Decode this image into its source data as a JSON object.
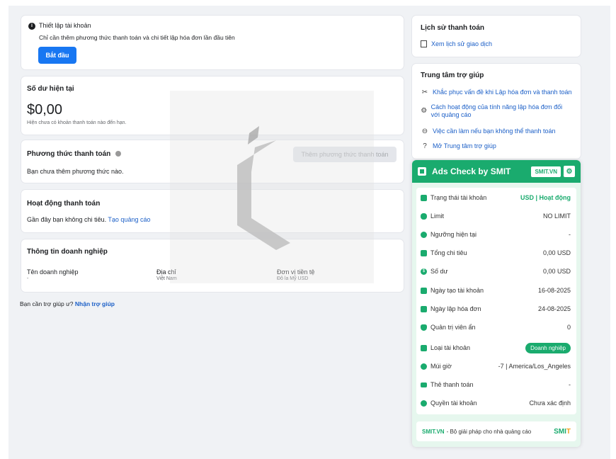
{
  "setup": {
    "title": "Thiết lập tài khoản",
    "desc": "Chỉ cần thêm phương thức thanh toán và chi tiết lập hóa đơn lần đầu tiên",
    "button": "Bắt đầu"
  },
  "balance": {
    "title": "Số dư hiện tại",
    "amount": "$0,00",
    "note": "Hiện chưa có khoản thanh toán nào đến hạn."
  },
  "payment_method": {
    "title": "Phương thức thanh toán",
    "desc": "Bạn chưa thêm phương thức nào.",
    "button": "Thêm phương thức thanh toán"
  },
  "activity": {
    "title": "Hoạt động thanh toán",
    "desc": "Gần đây bạn không chi tiêu.",
    "link": "Tạo quảng cáo"
  },
  "business": {
    "title": "Thông tin doanh nghiệp",
    "col1_label": "Tên doanh nghiệp",
    "col1_value": "-",
    "col2_label": "Địa chỉ",
    "col2_value": "Việt Nam",
    "col3_label": "Đơn vị tiền tệ",
    "col3_value": "Đô la Mỹ USD"
  },
  "help_footer": {
    "text": "Bạn cần trợ giúp ư?",
    "link": "Nhận trợ giúp"
  },
  "history": {
    "title": "Lịch sử thanh toán",
    "link": "Xem lịch sử giao dịch"
  },
  "help_center": {
    "title": "Trung tâm trợ giúp",
    "items": [
      "Khắc phục vấn đề khi Lập hóa đơn và thanh toán",
      "Cách hoạt động của tính năng lập hóa đơn đối với quảng cáo",
      "Việc cần làm nếu bạn không thể thanh toán",
      "Mở Trung tâm trợ giúp"
    ]
  },
  "smit": {
    "title": "Ads Check by SMIT",
    "tag": "SMIT.VN",
    "rows": [
      {
        "label": "Trạng thái tài khoản",
        "value": "USD | Hoạt động"
      },
      {
        "label": "Limit",
        "value": "NO LIMIT"
      },
      {
        "label": "Ngưỡng hiện tại",
        "value": "-"
      },
      {
        "label": "Tổng chi tiêu",
        "value": "0,00 USD"
      },
      {
        "label": "Số dư",
        "value": "0,00 USD"
      },
      {
        "label": "Ngày tạo tài khoản",
        "value": "16-08-2025"
      },
      {
        "label": "Ngày lập hóa đơn",
        "value": "24-08-2025"
      },
      {
        "label": "Quản trị viên ẩn",
        "value": "0"
      },
      {
        "label": "Loại tài khoản",
        "value": "Doanh nghiệp"
      },
      {
        "label": "Múi giờ",
        "value": "-7 | America/Los_Angeles"
      },
      {
        "label": "Thẻ thanh toán",
        "value": "-"
      },
      {
        "label": "Quyền tài khoản",
        "value": "Chưa xác định"
      }
    ],
    "footer_brand": "SMIT.VN",
    "footer_text": "- Bộ giải pháp cho nhà quảng cáo",
    "footer_logo_a": "SMI",
    "footer_logo_b": "T"
  },
  "colors": {
    "primary": "#1877f2",
    "smit_green": "#1aab6e",
    "link": "#1b5fc7"
  }
}
